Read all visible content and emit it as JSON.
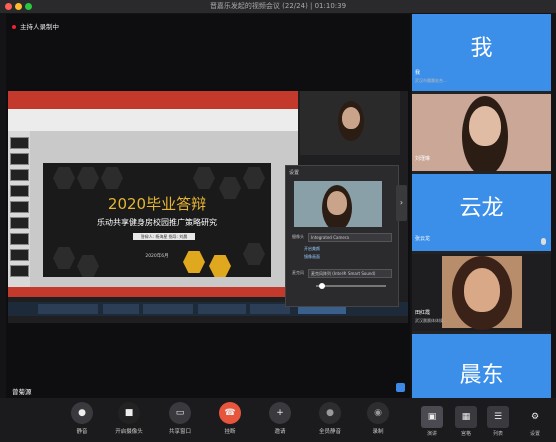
{
  "window": {
    "title": "晋嘉乐发起的视频会议 (22/24) | 01:10:39"
  },
  "recording": {
    "label": "主持人录制中"
  },
  "slide": {
    "title": "2020毕业答辩",
    "subtitle": "乐动共享健身房校园推广策略研究",
    "names": "答辩人: 杨海星 指导: 刘晨",
    "date": "2020年6月"
  },
  "settings_panel": {
    "title": "设置",
    "camera_label": "摄像头",
    "camera_value": "Integrated Camera",
    "opt1": "开启美颜",
    "opt2": "镜像画面",
    "mic_label": "麦克风",
    "mic_value": "麦克风阵列 (Intel® Smart Sound)"
  },
  "speaker": {
    "name": "曾菊源"
  },
  "participants": [
    {
      "avatar": "我",
      "name": "我",
      "sub": "武汉市晨晨宏合..."
    },
    {
      "avatar": "",
      "name": "刘瑾琳",
      "sub": ""
    },
    {
      "avatar": "云龙",
      "name": "张云龙",
      "sub": ""
    },
    {
      "avatar": "",
      "name": "田红霞",
      "sub": "武汉晨晨体体操..."
    },
    {
      "avatar": "晨东",
      "name": "",
      "sub": ""
    }
  ],
  "toolbar": {
    "mute": "静音",
    "camera": "开启摄像头",
    "share": "共享窗口",
    "end": "挂断",
    "invite": "邀请",
    "mute_all": "全员静音",
    "record": "录制",
    "view1": "演讲",
    "view2": "宫格",
    "view3": "列表",
    "settings": "设置"
  },
  "icons": [
    "mic-icon",
    "camera-icon",
    "share-icon",
    "phone-icon",
    "invite-icon",
    "mute-all-icon",
    "record-icon",
    "speaker-view-icon",
    "grid-view-icon",
    "list-view-icon",
    "gear-icon"
  ],
  "colors": {
    "avatar_blue": "#3c8fe8",
    "end_red": "#e8553d",
    "slide_gold": "#e7b532",
    "ppt_red": "#c33a2d"
  }
}
